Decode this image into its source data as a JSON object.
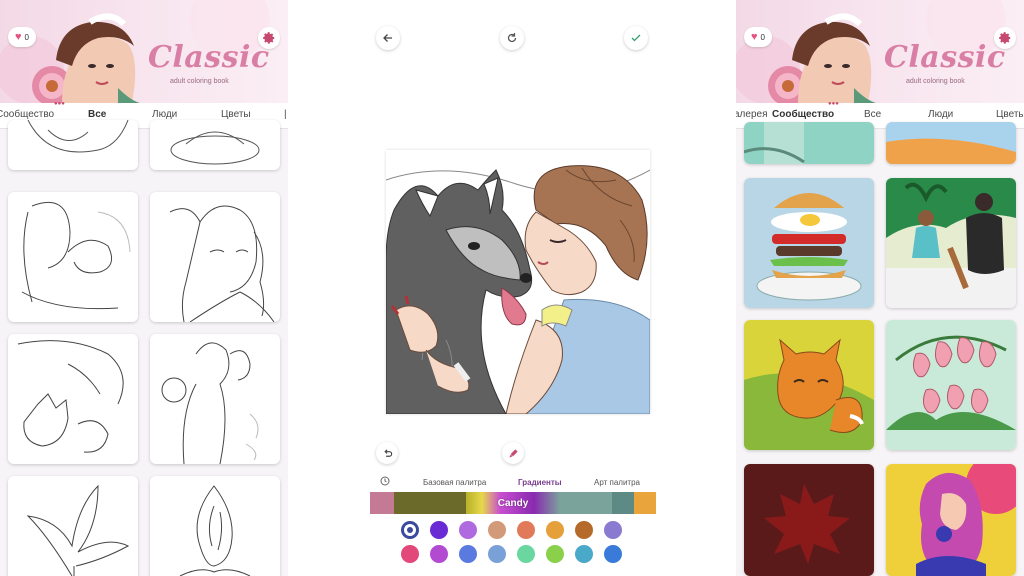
{
  "left_panel": {
    "likes_count": "0",
    "brand_title": "Classic",
    "brand_subtitle": "adult coloring book",
    "tabs": [
      "Сообщество",
      "Все",
      "Люди",
      "Цветы"
    ],
    "active_tab": "Все"
  },
  "editor": {
    "palette_tabs": [
      "Базовая палитра",
      "Градиенты",
      "Арт палитра"
    ],
    "active_palette_tab": "Градиенты",
    "selected_gradient": "Candy",
    "gradient_strip": [
      "#c47a95",
      "#6b6a2a",
      "#b9b12a",
      "#e6d84a",
      "#c94fd1",
      "#8a2ab0",
      "#7aa39c",
      "#5d8a84",
      "#e9a53b"
    ],
    "swatch_row_1": [
      "#3a4a9f",
      "#6a2ad4",
      "#b06adf",
      "#d39a7a",
      "#e07a5a",
      "#e5a03a",
      "#b56a2a",
      "#8a7ad0"
    ],
    "swatch_row_2": [
      "#e2487a",
      "#b24ad2",
      "#5a7ae0",
      "#7aa0d8",
      "#6ad6a0",
      "#8ad04a",
      "#4aa8c8",
      "#3a7ad8"
    ]
  },
  "right_panel": {
    "likes_count": "0",
    "brand_title": "Classic",
    "brand_subtitle": "adult coloring book",
    "tabs": [
      "алерея",
      "Сообщество",
      "Все",
      "Люди",
      "Цветы"
    ],
    "active_tab": "Сообщество"
  },
  "colors": {
    "accent": "#c7496f",
    "brand_pink": "#d97ea4"
  }
}
